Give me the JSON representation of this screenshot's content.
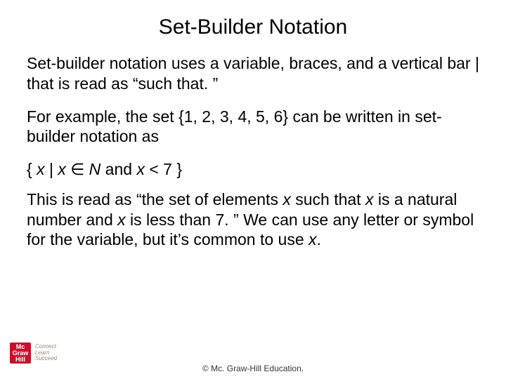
{
  "title": "Set-Builder Notation",
  "para1": "Set-builder notation uses a variable, braces, and a vertical bar | that is read as “such that. ”",
  "para2": "For example, the set {1, 2, 3, 4, 5, 6} can be written in set-builder notation as",
  "formula": {
    "open": "{ ",
    "x1": "x",
    "bar": " | ",
    "x2": "x",
    "in": " ∈ ",
    "N": "N",
    "and": " and ",
    "x3": "x",
    "lt": " < 7 }"
  },
  "para3a": "This is read as “the set of elements ",
  "para3b": "x",
  "para3c": " such that ",
  "para3d": "x",
  "para3e": " is a natural number and ",
  "para3f": "x",
  "para3g": " is less than 7. ” We can use any letter or symbol for the variable, but it’s common to use ",
  "para3h": "x",
  "para3i": ".",
  "logo": {
    "line1": "Mc",
    "line2": "Graw",
    "line3": "Hill",
    "t1": "Connect",
    "t2": "Learn",
    "t3": "Succeed"
  },
  "copyright": "© Mc. Graw-Hill Education."
}
